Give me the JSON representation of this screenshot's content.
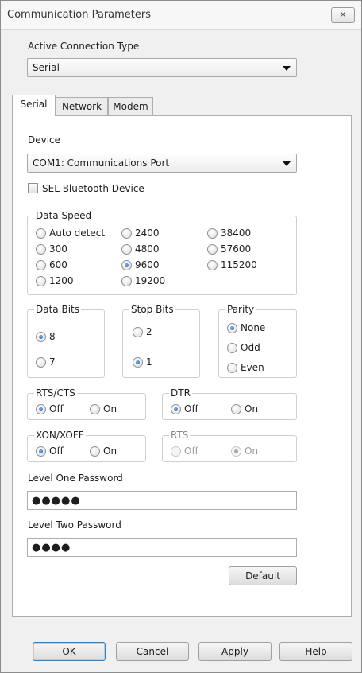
{
  "window": {
    "title": "Communication Parameters",
    "close_glyph": "✕"
  },
  "connection": {
    "label": "Active Connection Type",
    "value": "Serial"
  },
  "tabs": [
    {
      "label": "Serial",
      "active": true
    },
    {
      "label": "Network",
      "active": false
    },
    {
      "label": "Modem",
      "active": false
    }
  ],
  "device": {
    "label": "Device",
    "value": "COM1: Communications Port"
  },
  "bluetooth": {
    "label": "SEL Bluetooth Device",
    "checked": false
  },
  "data_speed": {
    "label": "Data Speed",
    "options": [
      "Auto detect",
      "300",
      "600",
      "1200",
      "2400",
      "4800",
      "9600",
      "19200",
      "38400",
      "57600",
      "115200"
    ],
    "selected": "9600"
  },
  "data_bits": {
    "label": "Data Bits",
    "options": [
      "8",
      "7"
    ],
    "selected": "8"
  },
  "stop_bits": {
    "label": "Stop Bits",
    "options": [
      "2",
      "1"
    ],
    "selected": "1"
  },
  "parity": {
    "label": "Parity",
    "options": [
      "None",
      "Odd",
      "Even"
    ],
    "selected": "None"
  },
  "rts_cts": {
    "label": "RTS/CTS",
    "off": "Off",
    "on": "On",
    "selected": "Off"
  },
  "dtr": {
    "label": "DTR",
    "off": "Off",
    "on": "On",
    "selected": "Off"
  },
  "xon_xoff": {
    "label": "XON/XOFF",
    "off": "Off",
    "on": "On",
    "selected": "Off"
  },
  "rts": {
    "label": "RTS",
    "off": "Off",
    "on": "On",
    "selected": "On",
    "disabled": true
  },
  "level_one": {
    "label": "Level One Password",
    "value": "●●●●●"
  },
  "level_two": {
    "label": "Level Two Password",
    "value": "●●●●"
  },
  "buttons": {
    "default": "Default",
    "ok": "OK",
    "cancel": "Cancel",
    "apply": "Apply",
    "help": "Help"
  },
  "colors": {
    "accent": "#1b55b5",
    "window_bg": "#f0f0f0"
  }
}
